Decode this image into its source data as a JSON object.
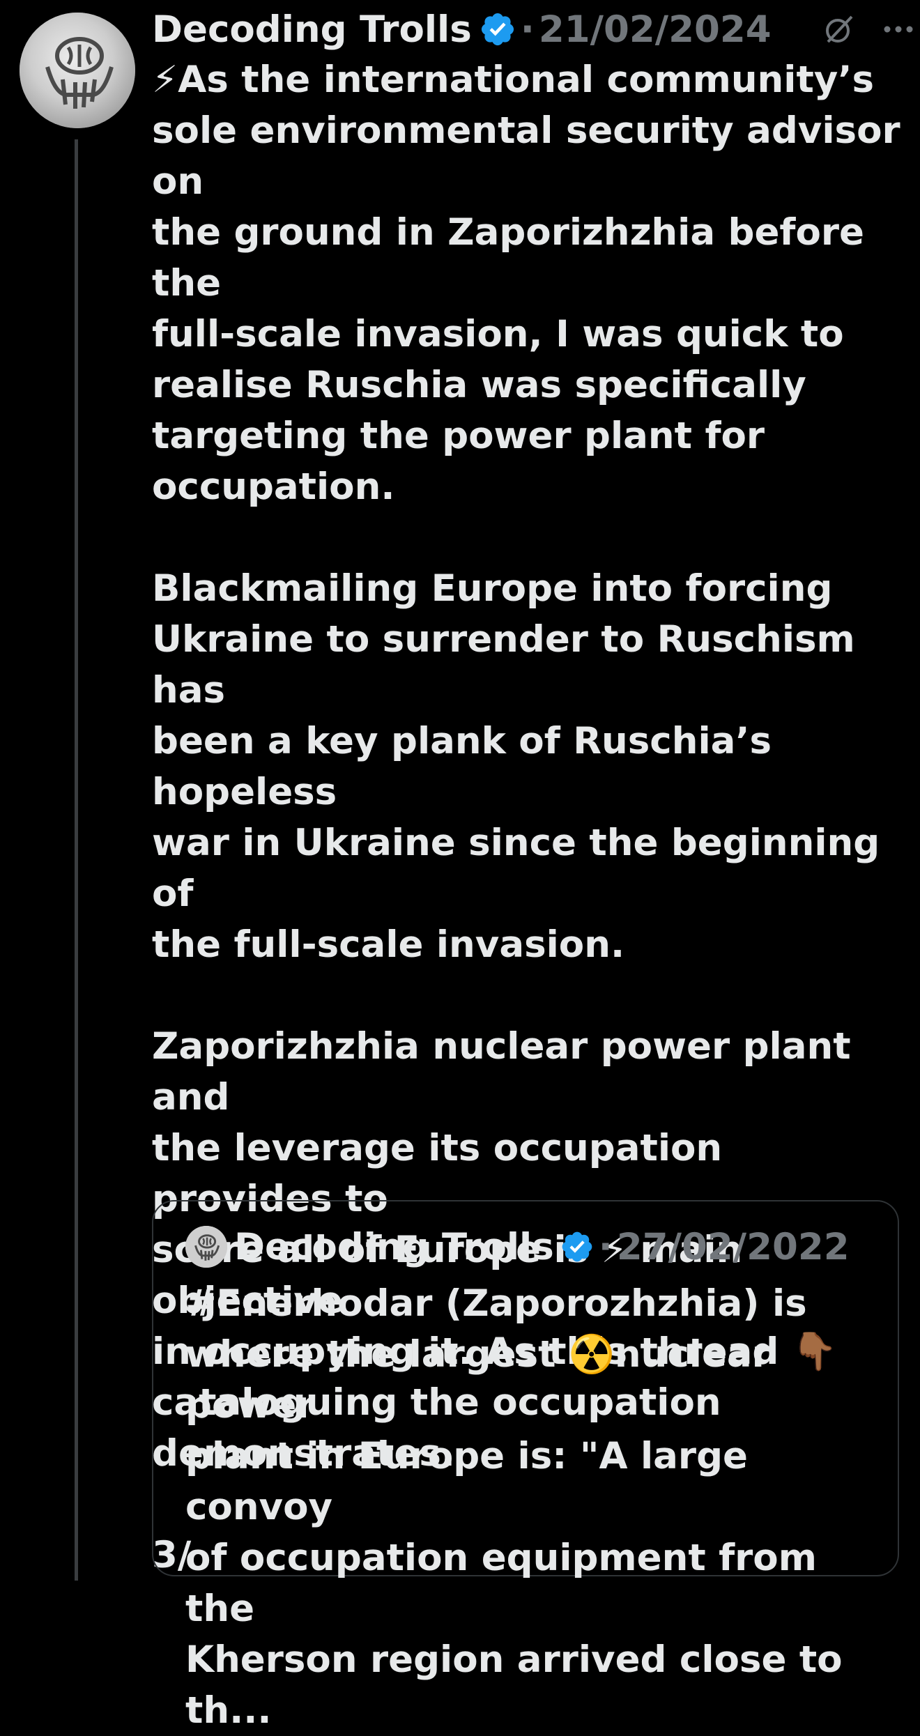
{
  "post": {
    "author": {
      "display_name": "Decoding Trolls",
      "verified": true,
      "avatar": "carved-emblem-avatar"
    },
    "separator": "·",
    "date": "21/02/2024",
    "icons": {
      "grok": "grok-icon",
      "more": "more-options-icon"
    },
    "text": "⚡As the international community’s\nsole environmental security advisor on\nthe ground in Zaporizhzhia before the\nfull-scale invasion, I was quick to\nrealise Ruschia was specifically\ntargeting the power plant for\noccupation.\n\nBlackmailing Europe into forcing\nUkraine to surrender to Ruschism has\nbeen a key plank of Ruschia’s hopeless\nwar in Ukraine since the beginning of\nthe full-scale invasion.\n\nZaporizhzhia nuclear power plant and\nthe leverage its occupation provides to\nscare all of Europe is ⚡ main objective\nin occupying it. As this thread 👇🏾\ncataloguing the occupation\ndemonstrates.\n\n3/"
  },
  "quoted_post": {
    "author": {
      "display_name": "Decoding Trolls",
      "verified": true
    },
    "separator": "·",
    "date": "27/02/2022",
    "text": "#Enerhodar (Zaporozhzhia) is\nwhere the largest ☢️nuclear power\nplant in Europe is: \"A large convoy\nof occupation equipment from the\nKherson region arrived close to th..."
  },
  "colors": {
    "background": "#000000",
    "text_primary": "#e7e9ea",
    "text_secondary": "#71767b",
    "verified_blue": "#1d9bf0",
    "border": "#2f3336",
    "thread_line": "#3a3d40"
  }
}
